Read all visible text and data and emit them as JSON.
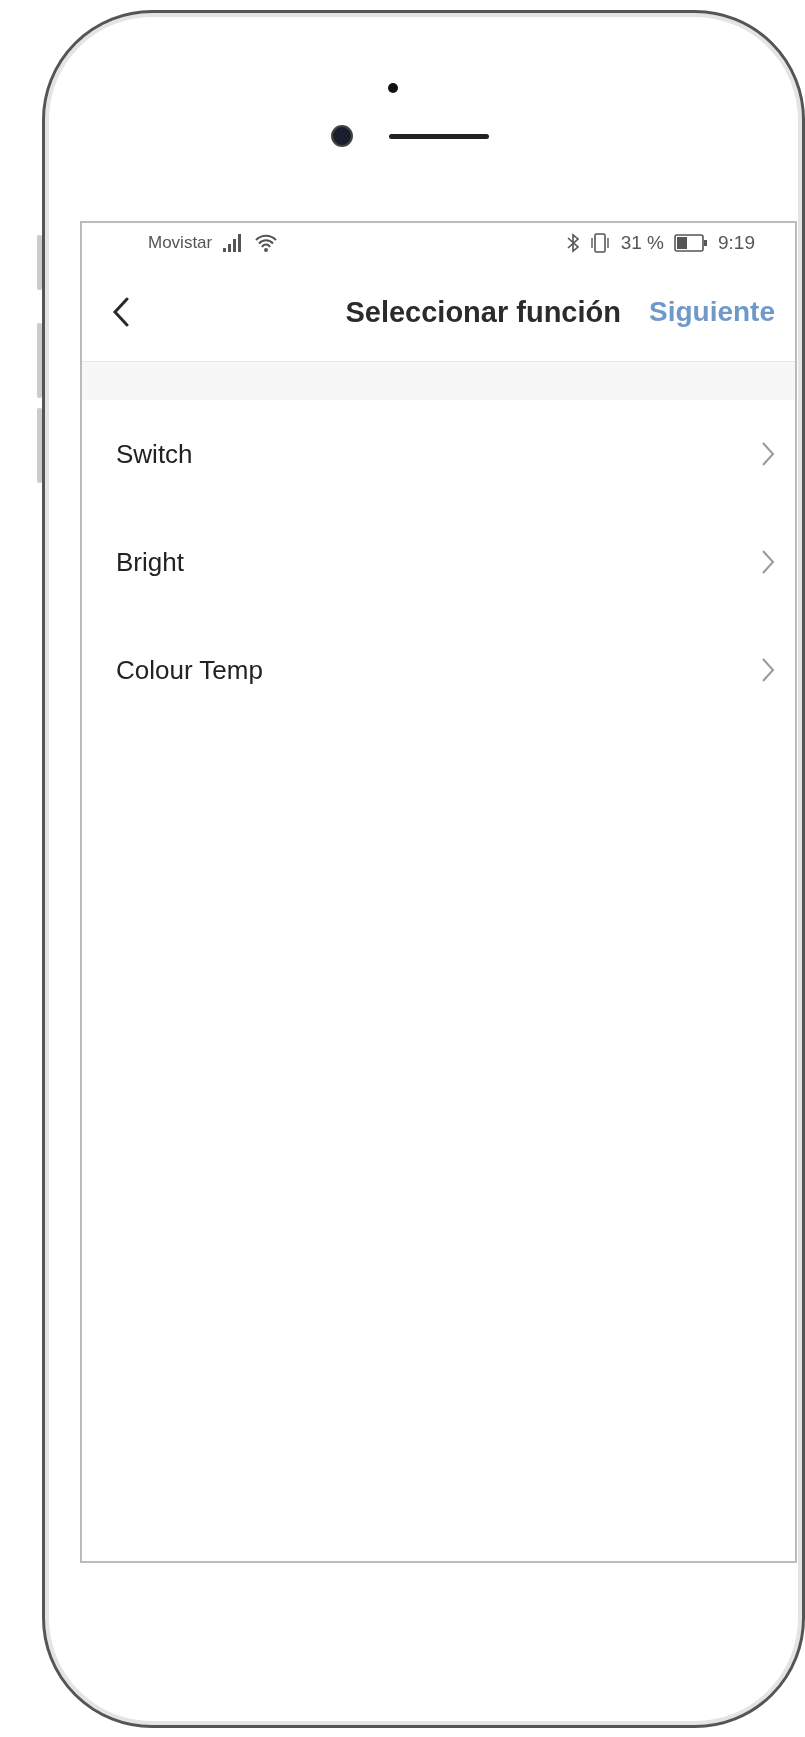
{
  "status_bar": {
    "carrier": "Movistar",
    "battery_percent": "31 %",
    "time": "9:19"
  },
  "header": {
    "title": "Seleccionar función",
    "action": "Siguiente"
  },
  "functions": [
    {
      "label": "Switch"
    },
    {
      "label": "Bright"
    },
    {
      "label": "Colour Temp"
    }
  ]
}
